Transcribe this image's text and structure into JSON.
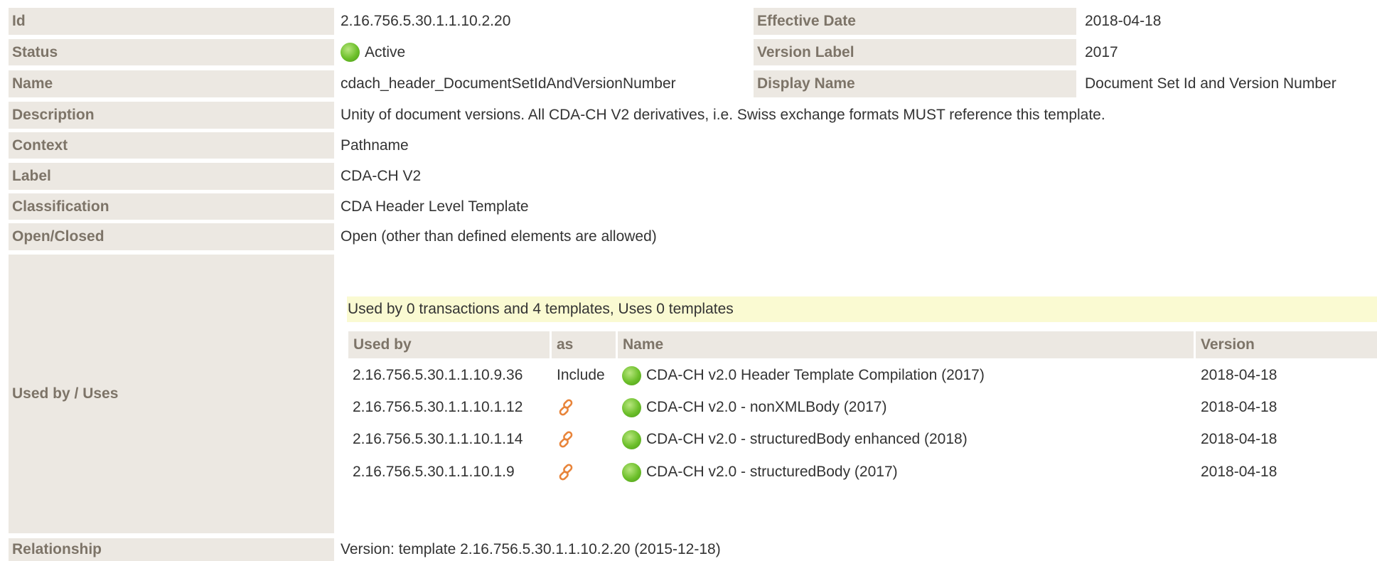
{
  "rows": {
    "id": {
      "label": "Id",
      "value": "2.16.756.5.30.1.1.10.2.20"
    },
    "effective_date": {
      "label": "Effective Date",
      "value": "2018-04-18"
    },
    "status": {
      "label": "Status",
      "value": "Active"
    },
    "version_label": {
      "label": "Version Label",
      "value": "2017"
    },
    "name": {
      "label": "Name",
      "value": "cdach_header_DocumentSetIdAndVersionNumber"
    },
    "display_name": {
      "label": "Display Name",
      "value": "Document Set Id and Version Number"
    },
    "description": {
      "label": "Description",
      "value": "Unity of document versions. All CDA-CH V2 derivatives, i.e. Swiss exchange formats MUST reference this template."
    },
    "context": {
      "label": "Context",
      "value": "Pathname"
    },
    "label": {
      "label": "Label",
      "value": "CDA-CH V2"
    },
    "classification": {
      "label": "Classification",
      "value": "CDA Header Level Template"
    },
    "open_closed": {
      "label": "Open/Closed",
      "value": "Open (other than defined elements are allowed)"
    },
    "used_by_uses": {
      "label": "Used by / Uses"
    },
    "relationship": {
      "label": "Relationship",
      "value": "Version: template 2.16.756.5.30.1.1.10.2.20 (2015-12-18)"
    }
  },
  "usage": {
    "summary": "Used by 0 transactions and 4 templates, Uses 0 templates",
    "headers": {
      "used_by": "Used by",
      "as": "as",
      "name": "Name",
      "version": "Version"
    },
    "rows": [
      {
        "used_by": "2.16.756.5.30.1.1.10.9.36",
        "as": "Include",
        "as_icon": null,
        "name": "CDA-CH v2.0 Header Template Compilation (2017)",
        "version": "2018-04-18"
      },
      {
        "used_by": "2.16.756.5.30.1.1.10.1.12",
        "as": "",
        "as_icon": "link-icon",
        "name": "CDA-CH v2.0 - nonXMLBody (2017)",
        "version": "2018-04-18"
      },
      {
        "used_by": "2.16.756.5.30.1.1.10.1.14",
        "as": "",
        "as_icon": "link-icon",
        "name": "CDA-CH v2.0 - structuredBody enhanced (2018)",
        "version": "2018-04-18"
      },
      {
        "used_by": "2.16.756.5.30.1.1.10.1.9",
        "as": "",
        "as_icon": "link-icon",
        "name": "CDA-CH v2.0 - structuredBody (2017)",
        "version": "2018-04-18"
      }
    ]
  },
  "colors": {
    "label_bg": "#ece8e2",
    "label_text": "#7d7468",
    "banner_bg": "#fafad2",
    "status_active": "#6cbf2a",
    "link_icon": "#e8843a"
  },
  "icons": {
    "status": "status-active-icon",
    "link": "link-icon"
  }
}
